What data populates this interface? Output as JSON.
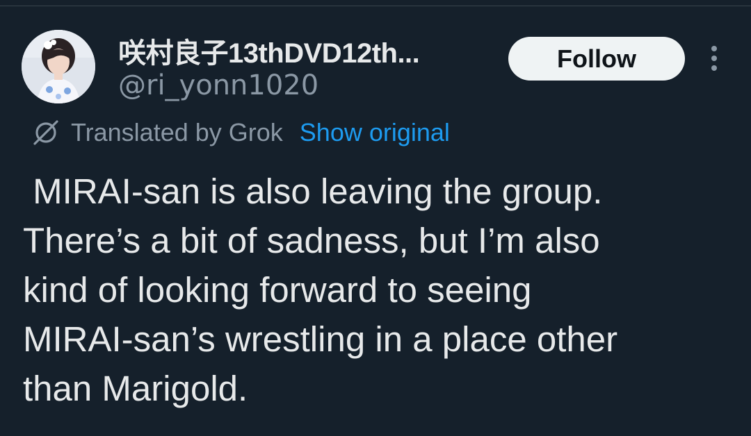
{
  "author": {
    "display_name": "咲村良子13thDVD12th...",
    "handle": "@ri_yonn1020"
  },
  "follow_button": {
    "label": "Follow"
  },
  "more_button": {
    "icon": "more-vertical-icon"
  },
  "translation": {
    "icon": "grok-icon",
    "label": "Translated by Grok",
    "show_original_label": "Show original"
  },
  "tweet": {
    "text": " MIRAI-san is also leaving the group.\nThere’s a bit of sadness, but I’m also\nkind of looking forward to seeing\nMIRAI-san’s wrestling in a place other\nthan Marigold."
  },
  "colors": {
    "background": "#15202b",
    "text_primary": "#e7e9ea",
    "text_secondary": "#8b98a5",
    "link": "#1d9bf0",
    "button_bg": "#eff3f4"
  }
}
